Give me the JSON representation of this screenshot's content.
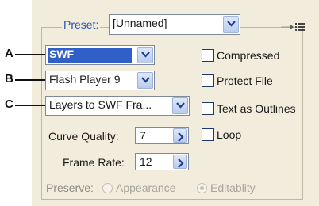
{
  "preset": {
    "label": "Preset:",
    "value": "[Unnamed]"
  },
  "callouts": {
    "a": "A",
    "b": "B",
    "c": "C"
  },
  "format": {
    "value": "SWF"
  },
  "flash_version": {
    "value": "Flash Player 9"
  },
  "export_as": {
    "value": "Layers to SWF Fra..."
  },
  "curve_quality": {
    "label": "Curve Quality:",
    "value": "7"
  },
  "frame_rate": {
    "label": "Frame Rate:",
    "value": "12"
  },
  "preserve": {
    "label": "Preserve:",
    "options": [
      "Appearance",
      "Editablity"
    ],
    "selected": "Editablity"
  },
  "options": {
    "compressed": "Compressed",
    "protect_file": "Protect File",
    "text_as_outlines": "Text as Outlines",
    "loop": "Loop"
  },
  "colors": {
    "panel": "#f1ecdc",
    "selection": "#2f5fc7",
    "label_blue": "#2a55b0"
  }
}
